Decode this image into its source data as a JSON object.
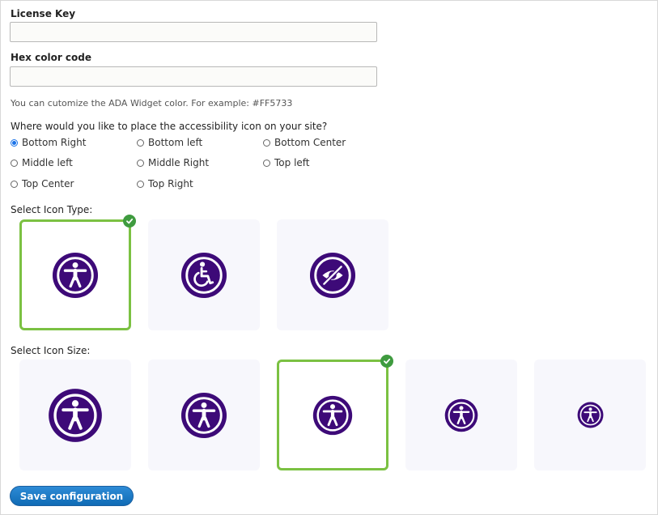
{
  "license": {
    "label": "License Key",
    "value": "",
    "placeholder": ""
  },
  "hex": {
    "label": "Hex color code",
    "value": "",
    "placeholder": "",
    "help": "You can cutomize the ADA Widget color. For example: #FF5733"
  },
  "position": {
    "question": "Where would you like to place the accessibility icon on your site?",
    "selected": "Bottom Right",
    "options": [
      "Bottom Right",
      "Bottom left",
      "Bottom Center",
      "Middle left",
      "Middle Right",
      "Top left",
      "Top Center",
      "Top Right"
    ]
  },
  "icon_type": {
    "label": "Select Icon Type:",
    "options": [
      "accessibility-person-icon",
      "wheelchair-icon",
      "eye-slash-icon"
    ],
    "selected_index": 0
  },
  "icon_size": {
    "label": "Select Icon Size:",
    "options": [
      "size-1",
      "size-2",
      "size-3",
      "size-4",
      "size-5"
    ],
    "selected_index": 2
  },
  "colors": {
    "icon_purple": "#3d0a78",
    "selected_border": "#7bc142",
    "check_green": "#3f9b3f",
    "button_blue": "#1a6fb8"
  },
  "save_button": "Save configuration"
}
